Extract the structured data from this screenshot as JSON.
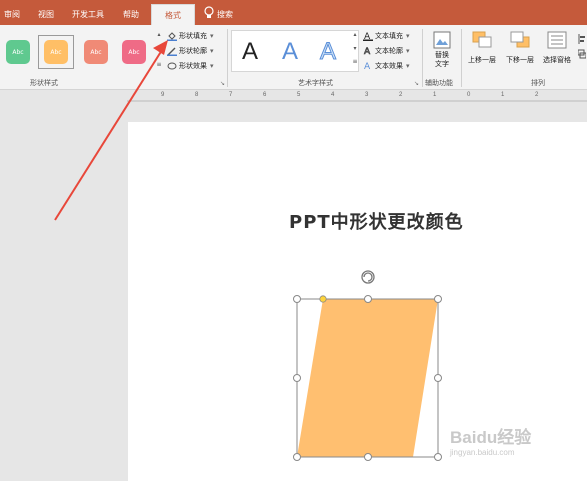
{
  "tabs": {
    "review": "审阅",
    "view": "视图",
    "developer": "开发工具",
    "help": "帮助",
    "format": "格式",
    "tell_me": "搜索"
  },
  "ribbon": {
    "shape_styles": {
      "label": "形状样式",
      "swatches": [
        {
          "text": "Abc",
          "color": "#5fc98f"
        },
        {
          "text": "Abc",
          "color": "#ffbf66"
        },
        {
          "text": "Abc",
          "color": "#f08a76"
        },
        {
          "text": "Abc",
          "color": "#ef6b86"
        }
      ],
      "fill": "形状填充",
      "outline": "形状轮廓",
      "effects": "形状效果"
    },
    "wordart": {
      "label": "艺术字样式",
      "samples": [
        "A",
        "A",
        "A"
      ],
      "text_fill": "文本填充",
      "text_outline": "文本轮廓",
      "text_effects": "文本效果"
    },
    "accessibility": {
      "label": "辅助功能",
      "alt_text_line1": "替换",
      "alt_text_line2": "文字"
    },
    "arrange": {
      "label": "排列",
      "bring_forward": "上移一层",
      "send_backward": "下移一层",
      "selection_pane": "选择窗格"
    }
  },
  "ruler": {
    "ticks": [
      "9",
      "8",
      "7",
      "6",
      "5",
      "4",
      "3",
      "2",
      "1",
      "0",
      "1",
      "2"
    ]
  },
  "slide": {
    "title": "PPT中形状更改颜色",
    "shape_color": "#ffbf70"
  },
  "watermark": {
    "brand": "Baidu经验",
    "url": "jingyan.baidu.com"
  },
  "colors": {
    "accent": "#c55a3b",
    "arrow": "#e8473a"
  }
}
